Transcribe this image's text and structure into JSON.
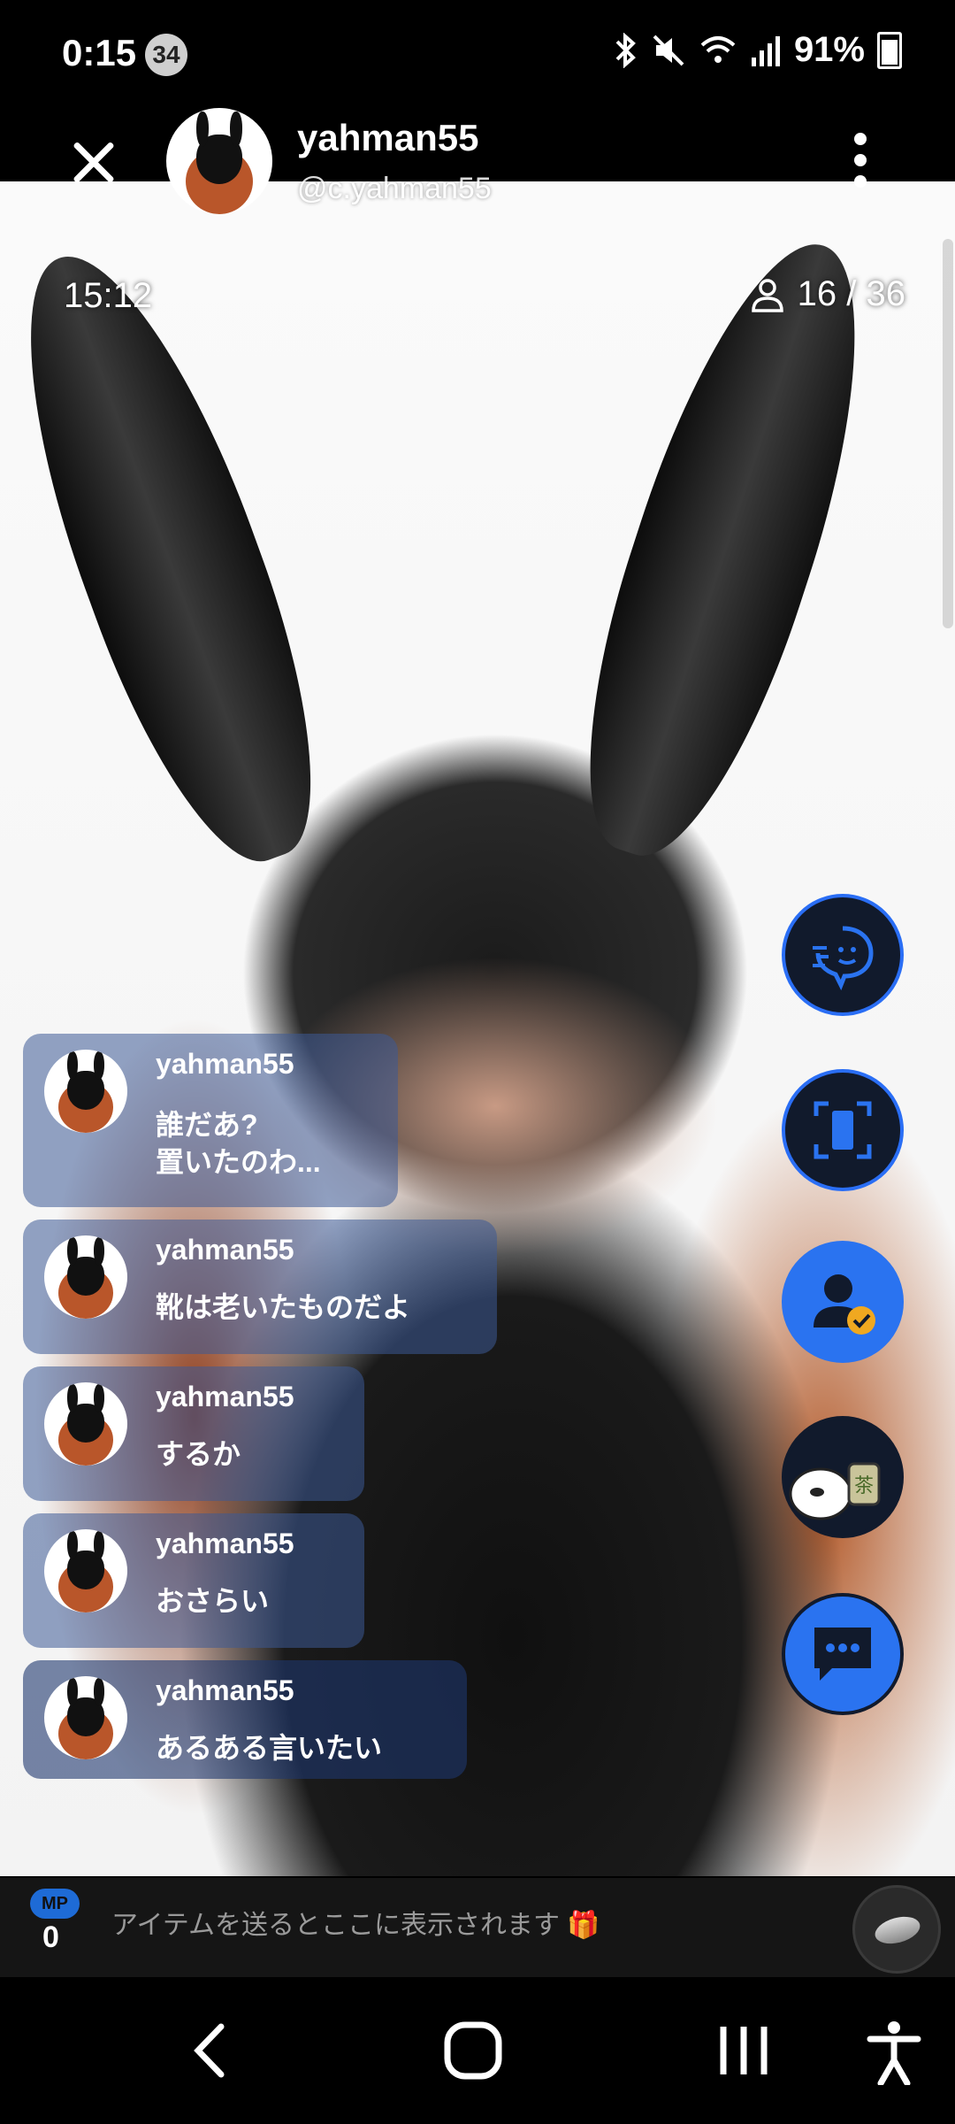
{
  "status_bar": {
    "time": "0:15",
    "notification_count": "34",
    "battery": "91%"
  },
  "header": {
    "host_name": "yahman55",
    "host_handle": "@c.yahman55"
  },
  "stream": {
    "elapsed": "15:12",
    "viewers": "16 / 36"
  },
  "comments": [
    {
      "user": "yahman55",
      "text": "誰だあ?\n置いたのわ..."
    },
    {
      "user": "yahman55",
      "text": "靴は老いたものだよ"
    },
    {
      "user": "yahman55",
      "text": "するか"
    },
    {
      "user": "yahman55",
      "text": "おさらい"
    },
    {
      "user": "yahman55",
      "text": "あるある言いたい"
    }
  ],
  "bottom": {
    "mp_label": "MP",
    "mp_count": "0",
    "item_hint": "アイテムを送るとここに表示されます",
    "gift_emoji": "🎁"
  },
  "side_buttons": [
    "chat-bot-icon",
    "screen-capture-icon",
    "user-verified-icon",
    "mascot-tea-icon",
    "comment-icon"
  ],
  "colors": {
    "accent": "#2a73f0",
    "bubble": "#3c5a96"
  }
}
